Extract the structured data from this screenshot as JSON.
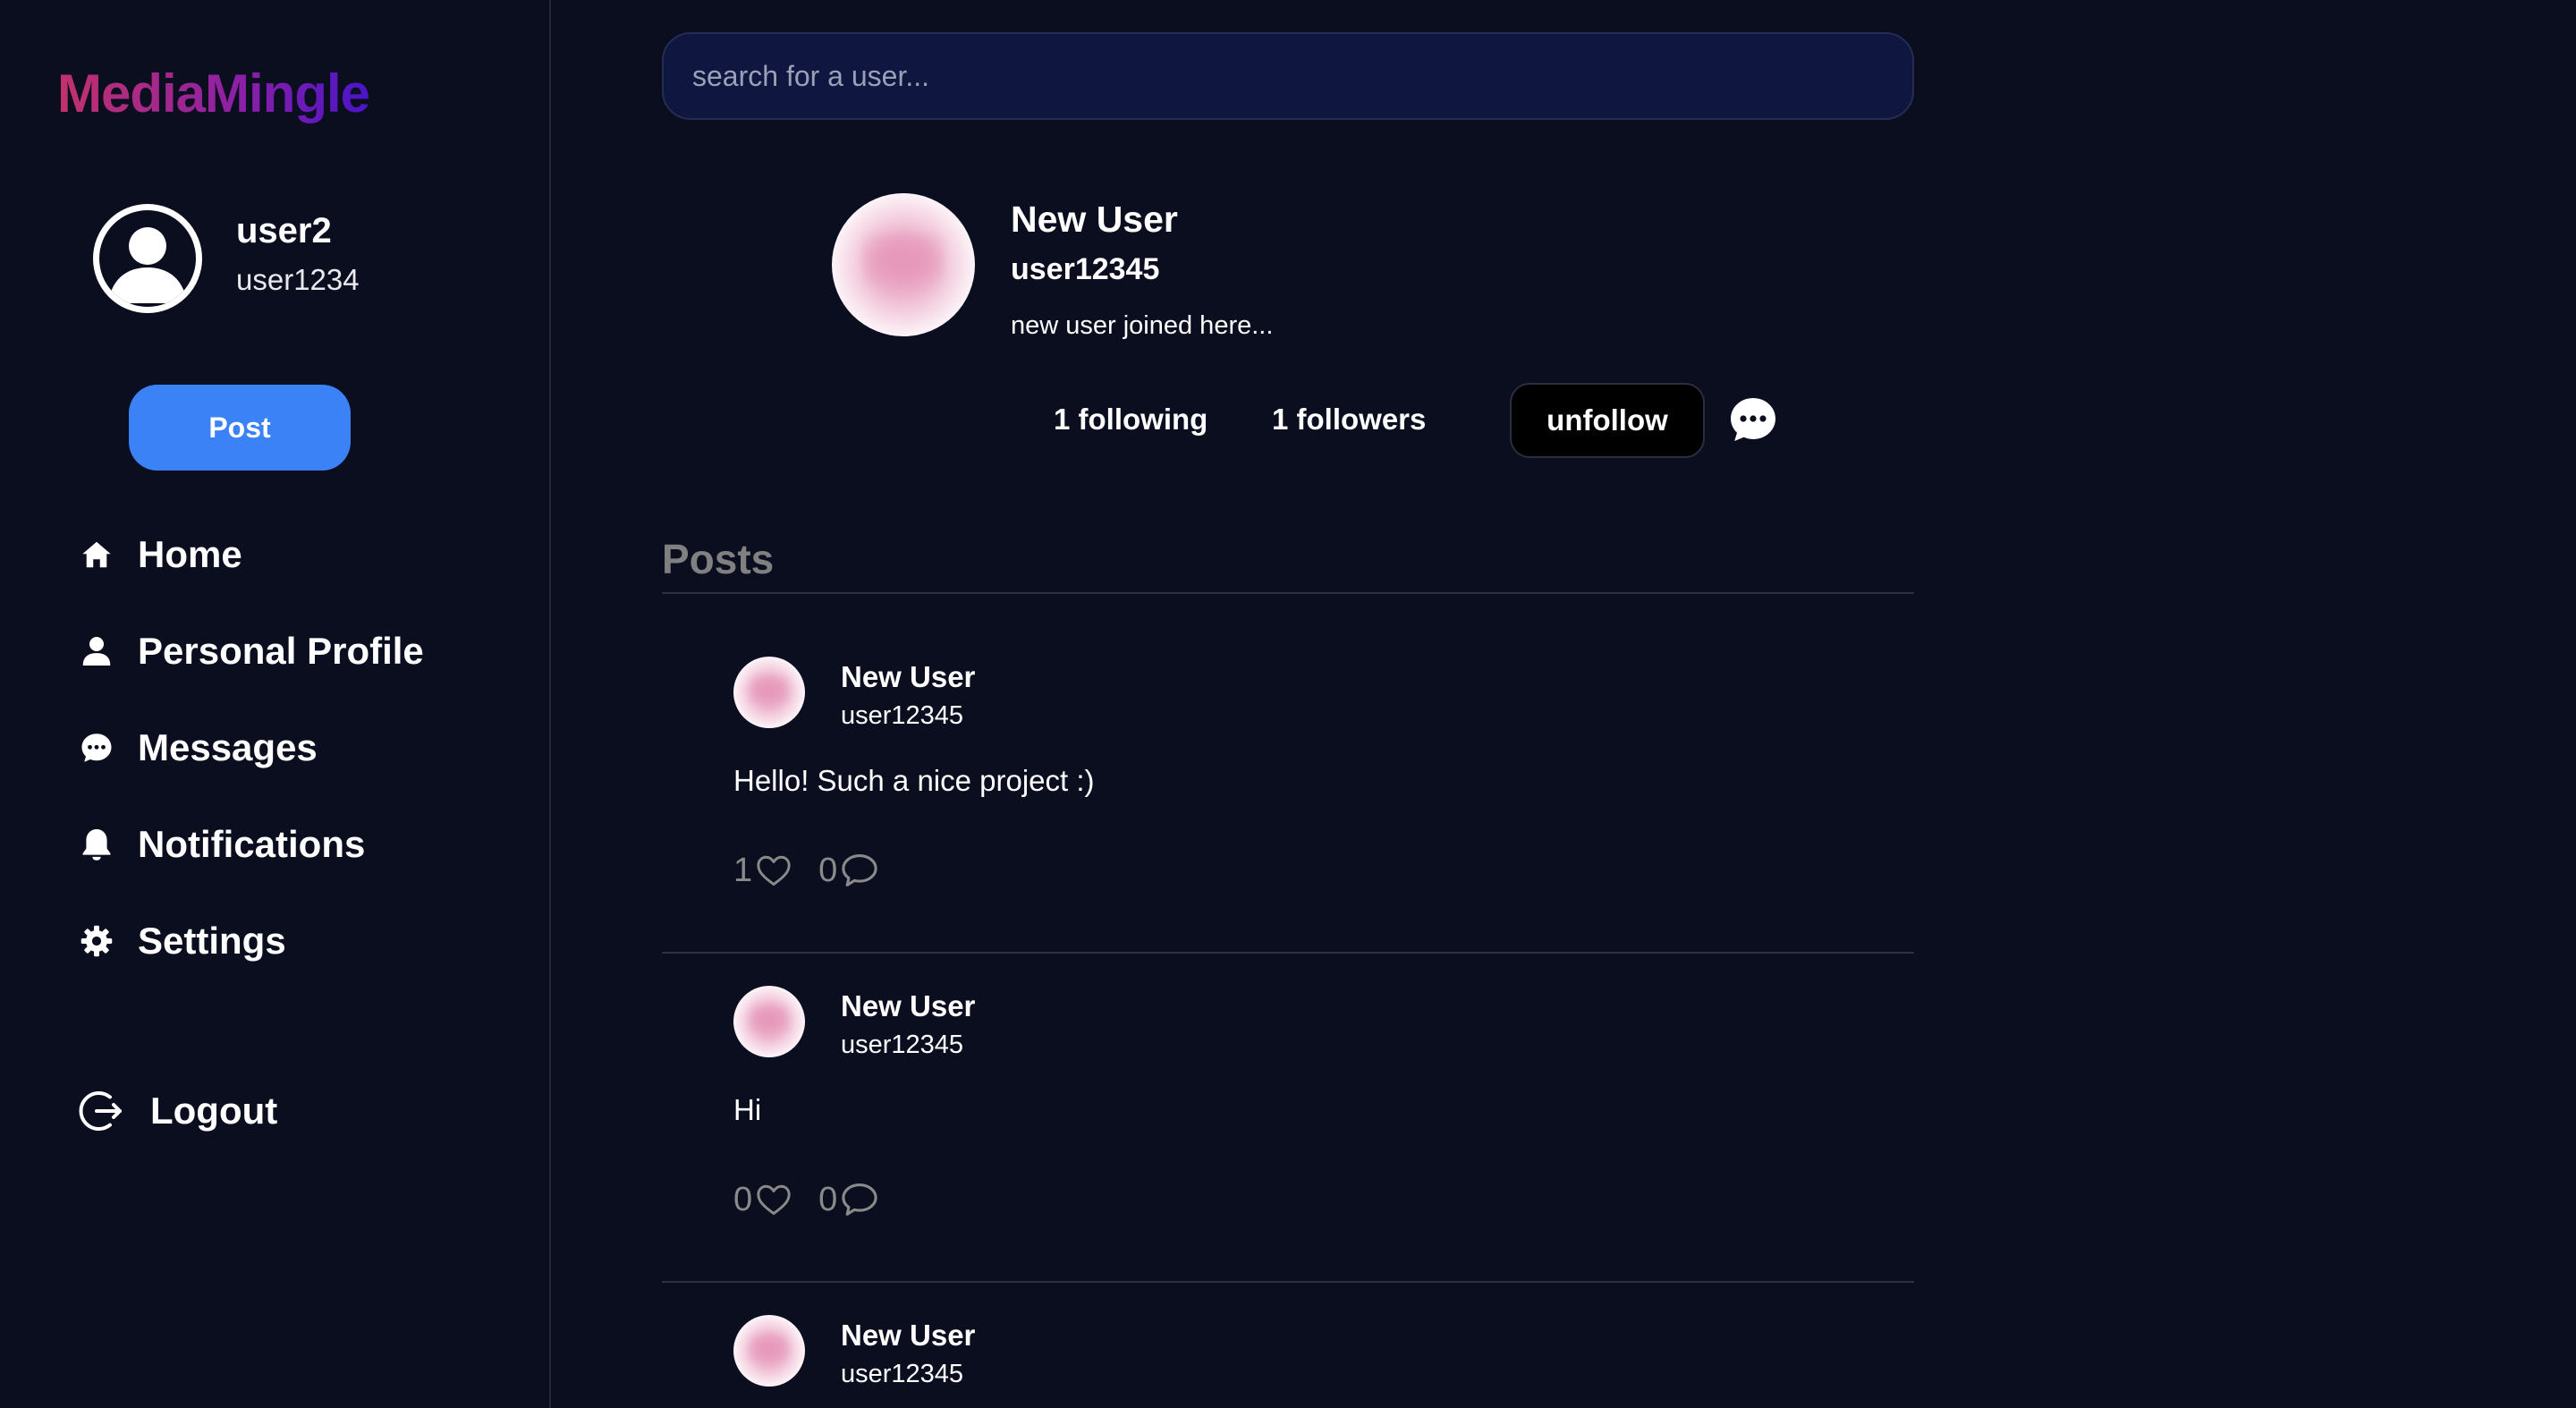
{
  "app": {
    "logo": "MediaMingle"
  },
  "current_user": {
    "name": "user2",
    "handle": "user1234"
  },
  "sidebar": {
    "post_label": "Post",
    "items": [
      {
        "label": "Home",
        "icon": "home-icon"
      },
      {
        "label": "Personal Profile",
        "icon": "person-icon"
      },
      {
        "label": "Messages",
        "icon": "chat-bubble-icon"
      },
      {
        "label": "Notifications",
        "icon": "bell-icon"
      },
      {
        "label": "Settings",
        "icon": "gear-icon"
      }
    ],
    "logout_label": "Logout"
  },
  "search": {
    "placeholder": "search for a user..."
  },
  "profile": {
    "name": "New User",
    "handle": "user12345",
    "bio": "new user joined here...",
    "following": "1 following",
    "followers": "1 followers",
    "unfollow_label": "unfollow"
  },
  "posts_heading": "Posts",
  "posts": [
    {
      "name": "New User",
      "handle": "user12345",
      "text": "Hello! Such a nice project :)",
      "likes": "1",
      "comments": "0"
    },
    {
      "name": "New User",
      "handle": "user12345",
      "text": "Hi",
      "likes": "0",
      "comments": "0"
    },
    {
      "name": "New User",
      "handle": "user12345",
      "text": "",
      "likes": "",
      "comments": ""
    }
  ],
  "colors": {
    "background": "#0a0e1f",
    "accent": "#3b82f6",
    "logo_gradient_start": "#c2326b",
    "logo_gradient_end": "#4a14c9"
  }
}
